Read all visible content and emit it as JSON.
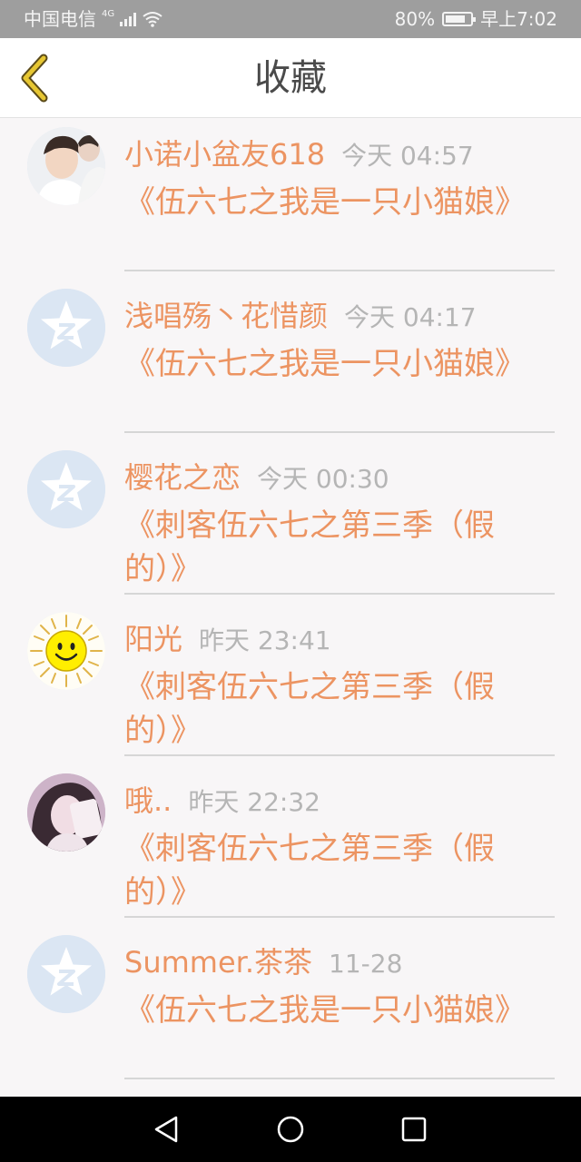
{
  "status": {
    "carrier": "中国电信",
    "network": "4G",
    "battery": "80%",
    "battery_level": 0.8,
    "time": "早上7:02"
  },
  "header": {
    "title": "收藏",
    "back_icon": "chevron-left-icon"
  },
  "colors": {
    "accent": "#ec9462",
    "time_gray": "#b5b5b5",
    "back_icon": "#e6c632"
  },
  "items": [
    {
      "name": "小诺小盆友618",
      "time": "今天 04:57",
      "book": "《伍六七之我是一只小猫娘》",
      "avatar": "photo-boy"
    },
    {
      "name": "浅唱殇丶花惜颜",
      "time": "今天 04:17",
      "book": "《伍六七之我是一只小猫娘》",
      "avatar": "default-star"
    },
    {
      "name": "樱花之恋",
      "time": "今天 00:30",
      "book": "《刺客伍六七之第三季（假的）》",
      "avatar": "default-star"
    },
    {
      "name": "阳光",
      "time": "昨天 23:41",
      "book": "《刺客伍六七之第三季（假的）》",
      "avatar": "sun-smiley"
    },
    {
      "name": "哦..",
      "time": "昨天 22:32",
      "book": "《刺客伍六七之第三季（假的）》",
      "avatar": "photo-girl"
    },
    {
      "name": "Summer.茶茶",
      "time": "11-28",
      "book": "《伍六七之我是一只小猫娘》",
      "avatar": "default-star"
    }
  ],
  "nav": {
    "back": "triangle-back-icon",
    "home": "circle-home-icon",
    "recents": "square-recents-icon"
  }
}
